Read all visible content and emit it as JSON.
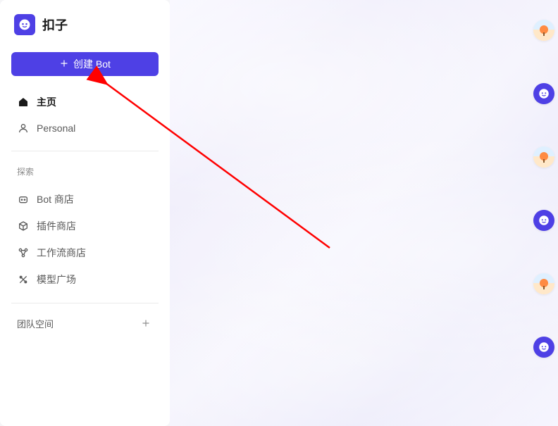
{
  "brand": {
    "title": "扣子"
  },
  "sidebar": {
    "create_button_label": "创建 Bot",
    "nav_home": "主页",
    "nav_personal": "Personal",
    "explore_label": "探索",
    "nav_bot_store": "Bot 商店",
    "nav_plugin_store": "插件商店",
    "nav_workflow_store": "工作流商店",
    "nav_model_plaza": "模型广场",
    "team_space_label": "团队空间"
  },
  "colors": {
    "primary": "#4E40E5"
  },
  "right_rail": {
    "items": [
      "avatar",
      "bot",
      "avatar",
      "bot",
      "avatar",
      "bot"
    ]
  }
}
